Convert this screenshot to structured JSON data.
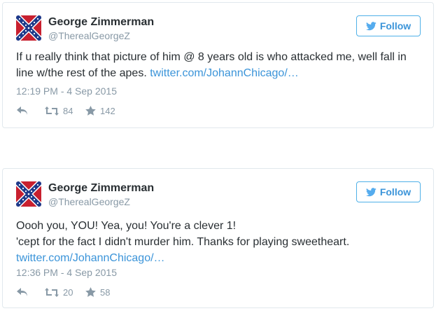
{
  "colors": {
    "link": "#3b94d9",
    "follow_border": "#4fb0e8",
    "muted": "#8899a6",
    "text": "#292f33",
    "card_border": "#e1e8ed"
  },
  "tweets": [
    {
      "display_name": "George Zimmerman",
      "handle": "@TherealGeorgeZ",
      "follow_label": "Follow",
      "text_line_1": "If u really think that picture of him @ 8 years old is who attacked me, well fall in",
      "text_line_2": "line w/the rest of the apes. ",
      "link": "twitter.com/JohannChicago/…",
      "timestamp": "12:19 PM - 4 Sep 2015",
      "retweets": "84",
      "favorites": "142",
      "icons": [
        "confederate-flag-avatar",
        "twitter-bird-icon",
        "reply-icon",
        "retweet-icon",
        "star-icon"
      ]
    },
    {
      "display_name": "George Zimmerman",
      "handle": "@TherealGeorgeZ",
      "follow_label": "Follow",
      "text_line_1": "Oooh you, YOU! Yea, you! You're a clever 1!",
      "text_line_2": "'cept for the fact I didn't murder him. Thanks for playing sweetheart.",
      "link": "twitter.com/JohannChicago/…",
      "timestamp": "12:36 PM - 4 Sep 2015",
      "retweets": "20",
      "favorites": "58",
      "icons": [
        "confederate-flag-avatar",
        "twitter-bird-icon",
        "reply-icon",
        "retweet-icon",
        "star-icon"
      ]
    }
  ]
}
